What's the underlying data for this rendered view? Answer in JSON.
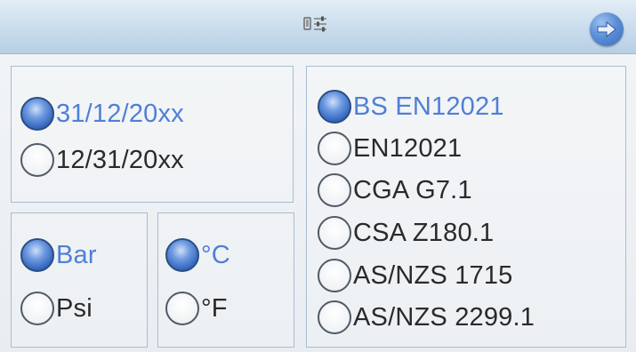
{
  "header": {
    "settings_icon": "settings-sliders-icon",
    "next_icon": "arrow-right-icon",
    "accent_color": "#4f7fd6"
  },
  "date_format": {
    "options": [
      {
        "label": "31/12/20xx",
        "selected": true
      },
      {
        "label": "12/31/20xx",
        "selected": false
      }
    ]
  },
  "pressure_unit": {
    "options": [
      {
        "label": "Bar",
        "selected": true
      },
      {
        "label": "Psi",
        "selected": false
      }
    ]
  },
  "temperature_unit": {
    "options": [
      {
        "label": "°C",
        "selected": true
      },
      {
        "label": "°F",
        "selected": false
      }
    ]
  },
  "standard": {
    "options": [
      {
        "label": "BS EN12021",
        "selected": true
      },
      {
        "label": "EN12021",
        "selected": false
      },
      {
        "label": "CGA G7.1",
        "selected": false
      },
      {
        "label": "CSA Z180.1",
        "selected": false
      },
      {
        "label": "AS/NZS 1715",
        "selected": false
      },
      {
        "label": "AS/NZS 2299.1",
        "selected": false
      }
    ]
  }
}
